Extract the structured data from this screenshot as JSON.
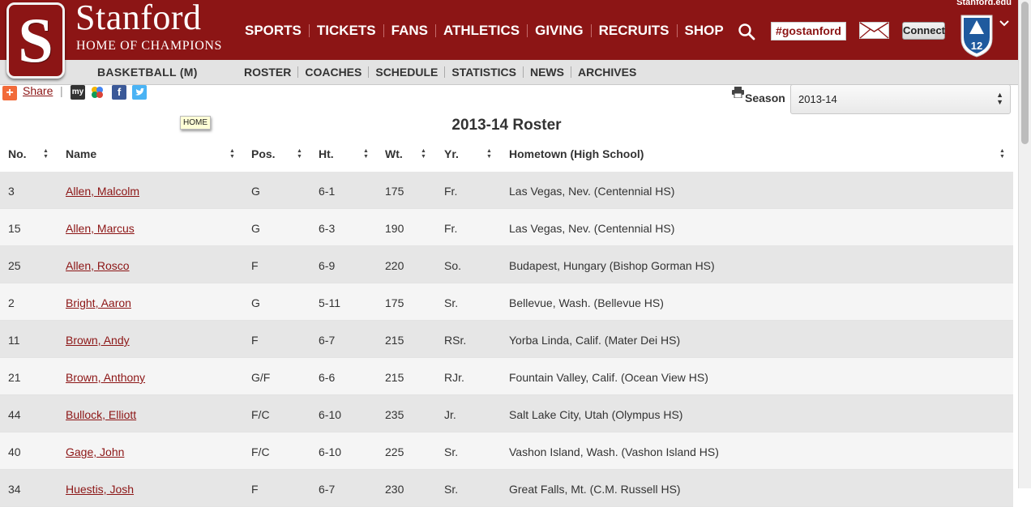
{
  "brand": {
    "title": "Stanford",
    "subtitle": "HOME OF CHAMPIONS",
    "logo_letter": "S",
    "site_link": "Stanford.edu"
  },
  "main_nav": [
    {
      "label": "SPORTS"
    },
    {
      "label": "TICKETS"
    },
    {
      "label": "FANS"
    },
    {
      "label": "ATHLETICS"
    },
    {
      "label": "GIVING"
    },
    {
      "label": "RECRUITS"
    },
    {
      "label": "SHOP"
    }
  ],
  "header_actions": {
    "hashtag": "#gostanford",
    "connect": "Connect",
    "conference_badge": "12"
  },
  "subnav": {
    "sport": "BASKETBALL (M)",
    "items": [
      {
        "label": "ROSTER"
      },
      {
        "label": "COACHES"
      },
      {
        "label": "SCHEDULE"
      },
      {
        "label": "STATISTICS"
      },
      {
        "label": "NEWS"
      },
      {
        "label": "ARCHIVES"
      }
    ]
  },
  "share": {
    "label": "Share",
    "separator": "|",
    "tooltip": "HOME",
    "social_icons": [
      "myyahoo-icon",
      "google-icon",
      "facebook-icon",
      "twitter-icon"
    ],
    "myyahoo_text": "my",
    "facebook_text": "f"
  },
  "season": {
    "label": "Season",
    "value": "2013-14"
  },
  "roster": {
    "title": "2013-14 Roster",
    "columns": [
      "No.",
      "Name",
      "Pos.",
      "Ht.",
      "Wt.",
      "Yr.",
      "Hometown (High School)"
    ],
    "rows": [
      {
        "no": "3",
        "name": "Allen, Malcolm",
        "pos": "G",
        "ht": "6-1",
        "wt": "175",
        "yr": "Fr.",
        "hometown": "Las Vegas, Nev. (Centennial HS)"
      },
      {
        "no": "15",
        "name": "Allen, Marcus",
        "pos": "G",
        "ht": "6-3",
        "wt": "190",
        "yr": "Fr.",
        "hometown": "Las Vegas, Nev. (Centennial HS)"
      },
      {
        "no": "25",
        "name": "Allen, Rosco",
        "pos": "F",
        "ht": "6-9",
        "wt": "220",
        "yr": "So.",
        "hometown": "Budapest, Hungary (Bishop Gorman HS)"
      },
      {
        "no": "2",
        "name": "Bright, Aaron",
        "pos": "G",
        "ht": "5-11",
        "wt": "175",
        "yr": "Sr.",
        "hometown": "Bellevue, Wash. (Bellevue HS)"
      },
      {
        "no": "11",
        "name": "Brown, Andy",
        "pos": "F",
        "ht": "6-7",
        "wt": "215",
        "yr": "RSr.",
        "hometown": "Yorba Linda, Calif. (Mater Dei HS)"
      },
      {
        "no": "21",
        "name": "Brown, Anthony",
        "pos": "G/F",
        "ht": "6-6",
        "wt": "215",
        "yr": "RJr.",
        "hometown": "Fountain Valley, Calif. (Ocean View HS)"
      },
      {
        "no": "44",
        "name": "Bullock, Elliott",
        "pos": "F/C",
        "ht": "6-10",
        "wt": "235",
        "yr": "Jr.",
        "hometown": "Salt Lake City, Utah (Olympus HS)"
      },
      {
        "no": "40",
        "name": "Gage, John",
        "pos": "F/C",
        "ht": "6-10",
        "wt": "225",
        "yr": "Sr.",
        "hometown": "Vashon Island, Wash. (Vashon Island HS)"
      },
      {
        "no": "34",
        "name": "Huestis, Josh",
        "pos": "F",
        "ht": "6-7",
        "wt": "230",
        "yr": "Sr.",
        "hometown": "Great Falls, Mt. (C.M. Russell HS)"
      }
    ]
  },
  "colors": {
    "cardinal": "#8c1515",
    "row_odd": "#e6e6e6",
    "row_even": "#f5f5f5"
  }
}
